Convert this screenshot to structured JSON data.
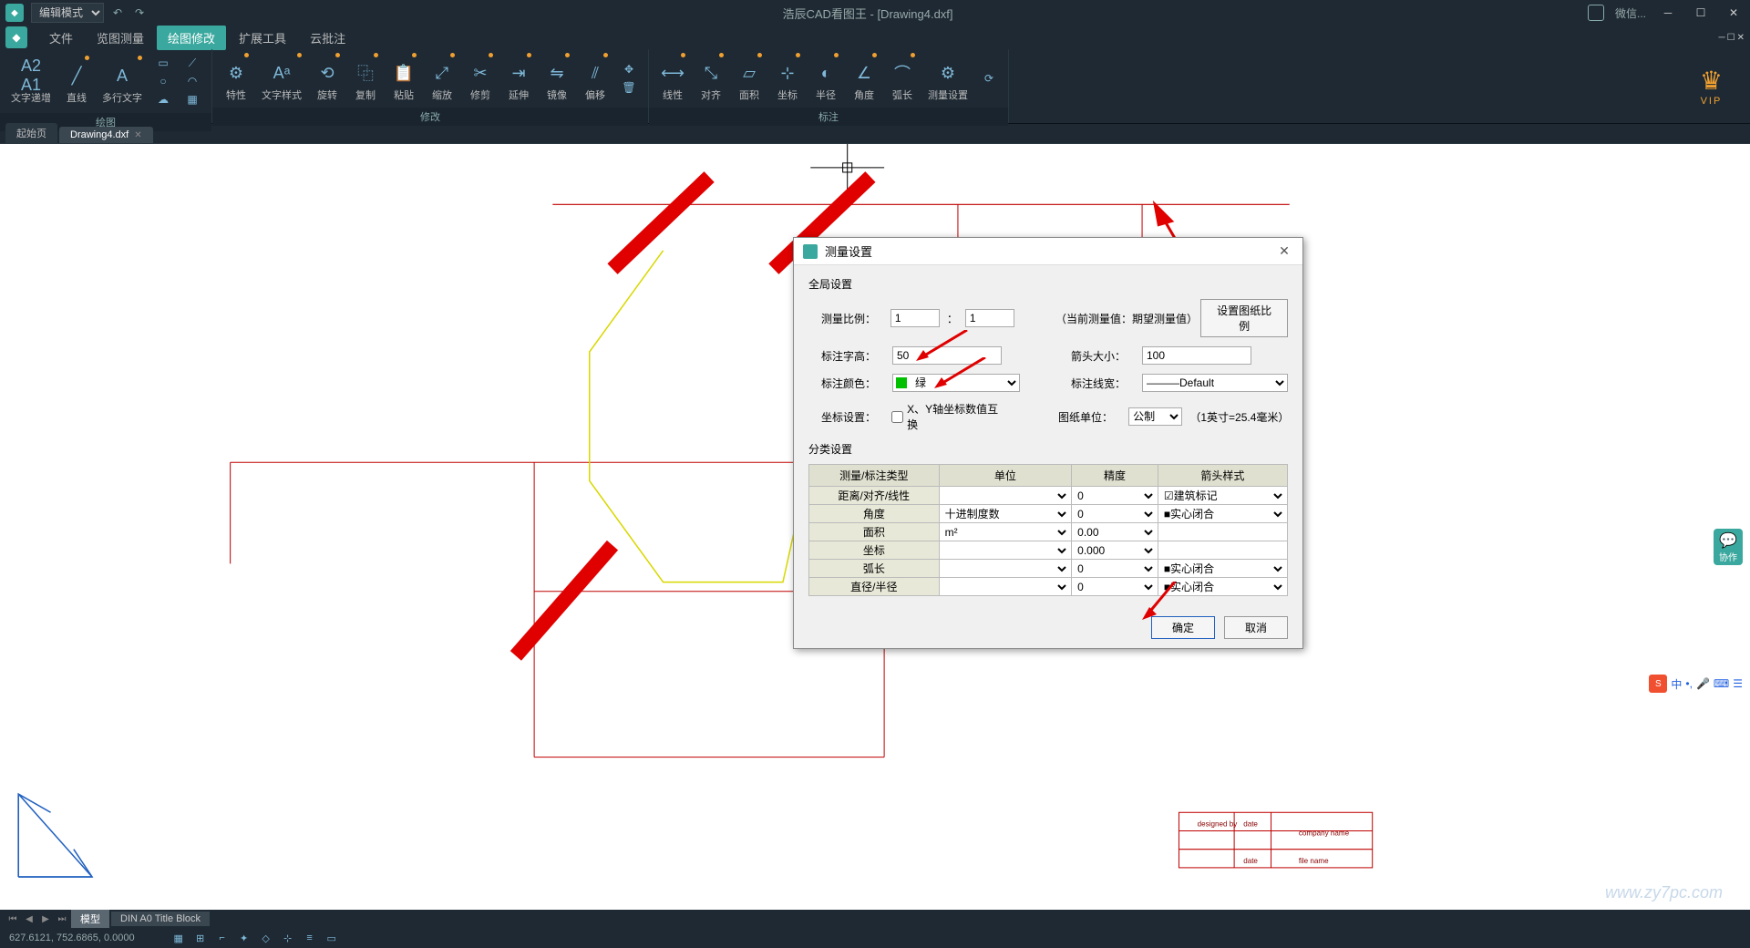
{
  "app": {
    "mode": "编辑模式",
    "title": "浩辰CAD看图王 - [Drawing4.dxf]",
    "wechat": "微信...",
    "vip": "VIP"
  },
  "menus": [
    "文件",
    "览图测量",
    "绘图修改",
    "扩展工具",
    "云批注"
  ],
  "active_menu_index": 2,
  "ribbon": {
    "groups": [
      {
        "label": "绘图",
        "buttons": [
          "文字递增",
          "直线",
          "多行文字"
        ]
      },
      {
        "label": "修改",
        "buttons": [
          "特性",
          "文字样式",
          "旋转",
          "复制",
          "粘贴",
          "缩放",
          "修剪",
          "延伸",
          "镜像",
          "偏移"
        ]
      },
      {
        "label": "标注",
        "buttons": [
          "线性",
          "对齐",
          "面积",
          "坐标",
          "半径",
          "角度",
          "弧长",
          "测量设置"
        ]
      }
    ]
  },
  "tabs": {
    "start": "起始页",
    "file": "Drawing4.dxf"
  },
  "dialog": {
    "title": "测量设置",
    "global_section": "全局设置",
    "ratio_label": "测量比例：",
    "ratio_val1": "1",
    "ratio_sep": "：",
    "ratio_val2": "1",
    "ratio_hint": "（当前测量值：期望测量值）",
    "ratio_btn": "设置图纸比例",
    "text_height_label": "标注字高：",
    "text_height_val": "50",
    "arrow_size_label": "箭头大小：",
    "arrow_size_val": "100",
    "color_label": "标注颜色：",
    "color_val": "绿",
    "lineweight_label": "标注线宽：",
    "lineweight_val": "———Default",
    "coord_label": "坐标设置：",
    "coord_check": "X、Y轴坐标数值互换",
    "unit_label": "图纸单位：",
    "unit_val": "公制",
    "unit_hint": "（1英寸=25.4毫米）",
    "category_section": "分类设置",
    "table_headers": [
      "测量/标注类型",
      "单位",
      "精度",
      "箭头样式"
    ],
    "table_rows": [
      {
        "type": "距离/对齐/线性",
        "unit": "",
        "precision": "0",
        "arrow": "☑建筑标记"
      },
      {
        "type": "角度",
        "unit": "十进制度数",
        "precision": "0",
        "arrow": "■实心闭合"
      },
      {
        "type": "面积",
        "unit": "m²",
        "precision": "0.00",
        "arrow": ""
      },
      {
        "type": "坐标",
        "unit": "",
        "precision": "0.000",
        "arrow": ""
      },
      {
        "type": "弧长",
        "unit": "",
        "precision": "0",
        "arrow": "■实心闭合"
      },
      {
        "type": "直径/半径",
        "unit": "",
        "precision": "0",
        "arrow": "■实心闭合"
      }
    ],
    "ok": "确定",
    "cancel": "取消"
  },
  "bottom_tabs": {
    "model": "模型",
    "layout": "DIN A0 Title Block"
  },
  "statusbar": {
    "coords": "627.6121, 752.6865, 0.0000"
  },
  "title_block": {
    "designed_by": "designed by",
    "date_label": "date",
    "company": "company name",
    "filename": "file name"
  },
  "side_float": "协作",
  "ime": "中",
  "watermark": "www.zy7pc.com"
}
